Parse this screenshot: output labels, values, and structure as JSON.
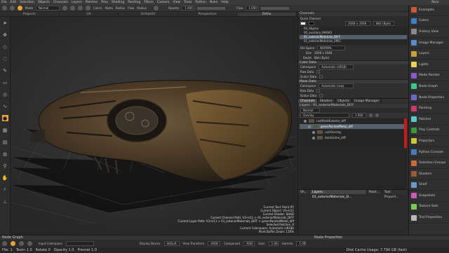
{
  "menubar": {
    "items": [
      "File",
      "Edit",
      "Selection",
      "Objects",
      "Channels",
      "Layers",
      "Patches",
      "Prex",
      "Shading",
      "Painting",
      "Filters",
      "Camera",
      "View",
      "Tools",
      "Python",
      "Nuke",
      "Help"
    ],
    "right_label": "Near"
  },
  "toolbar": {
    "mode_label": "Mode",
    "mode_value": "Normal",
    "colors_label": "Colors",
    "alpha_label": "Alpha",
    "radius_label": "Radius",
    "flow_label": "Flow",
    "radius2_label": "Radius",
    "opacity_label": "Opacity",
    "opacity_value": "1.000",
    "flow2_label": "Flow",
    "flow2_value": "1.000"
  },
  "view_tabs": [
    "Projects",
    "UV",
    "Ortho/UV",
    "Perspective",
    "Ortho"
  ],
  "active_view_tab": 4,
  "viewport": {
    "hud": [
      "Current Tool: Paint (P)",
      "Current Object: V3-m11",
      "Current Shader: SHAD",
      "Current Channel Path: V3-m11 > 01_exteriorMaterials_DIFF",
      "Current Layer Path: V3-m11 > 01_exteriorMaterials_DIFF > greenPaintedMetal_diff",
      "Selected Patches: 0",
      "Current Colorspace: Automatic (sRGB)",
      "Paint Buffer Zoom: 116%"
    ]
  },
  "right_panel": {
    "channels_title": "Channels",
    "quick_channel_label": "Quick Channel",
    "size_value": "2048 × 2048",
    "depth_value": "8bit (Byte)",
    "channel_list": [
      "00_Sbgrey",
      "00_auxiliary_MASKS",
      "01_exteriorMaterials_DIFF",
      "01_exteriorMaterials_SPEC"
    ],
    "selected_channel": 2,
    "file_space_label": "File Space",
    "file_space_value": "NORMAL",
    "size_label": "Size",
    "size2_value": "2048 x 2048",
    "depth_label": "Depth",
    "depth2_value": "8bit (Byte)",
    "color_data_label": "Color Data",
    "colorspace_label": "Colorspace",
    "colorspace_value": "Automatic (sRGB)",
    "raw_data_label": "Raw Data",
    "scalar_data_label": "Scalar Data",
    "mask_data_label": "Mask Data",
    "colorspace2_value": "Automatic (raw)",
    "sub_tabs": [
      "Channels",
      "Shaders",
      "Objects",
      "Image Manager"
    ],
    "active_sub_tab": 0,
    "layers_path": "Layers : 01_exteriorMaterials_DIFF",
    "blend_value": "Normal",
    "blend_mode": "Overlay",
    "blend_opacity": "1.000",
    "layers": [
      "rustPaintExterior_diff",
      "greenPaintedMetal_diff",
      "rustOverlay",
      "darkGrime_diff"
    ],
    "selected_layer": 1,
    "bottom_tabs": [
      "Sh...",
      "Layers : 01_exteriorMaterials_D...",
      "Palet...",
      "Tool Propert..."
    ]
  },
  "shelf": {
    "items": [
      "Examples",
      "Colors",
      "History View",
      "Image Manager",
      "Layers",
      "Lights",
      "Mode Render",
      "Node Graph",
      "Node Properties",
      "Painting",
      "Patches",
      "Play Controls",
      "Projectors",
      "Python Console",
      "Selection Groups",
      "Shaders",
      "Shelf",
      "Snapshots",
      "Texture Sets",
      "Tool Properties"
    ],
    "colors": [
      "#c85a3a",
      "#3a7fc8",
      "#8a8a8a",
      "#5a8ac8",
      "#c8a03a",
      "#e8d05a",
      "#8a5ac8",
      "#3ac88a",
      "#6a6ac8",
      "#c83a6a",
      "#5ac8c8",
      "#3a9a3a",
      "#c8c83a",
      "#4a7ab8",
      "#c86a3a",
      "#9a5a3a",
      "#6a9ac8",
      "#c85ab8",
      "#7ac85a",
      "#b8b8b8"
    ]
  },
  "bottom": {
    "node_graph_label": "Node Graph",
    "node_properties_label": "Node Properties",
    "input_colorspace_label": "Input Colorspace",
    "display_device_label": "Display Device",
    "display_device_value": "default",
    "view_transform_label": "View Transform",
    "view_transform_value": "sRGB",
    "component_label": "Component",
    "component_value": "RGB",
    "gain_label": "Gain",
    "gain_value": "1.00",
    "gamma_label": "Gamma",
    "gamma_value": "1.00",
    "status_left": [
      "File: 1",
      "Textn 1.0",
      "Rotate 0",
      "Opacity 1.0",
      "Fresnel 1.0"
    ],
    "status_right": "Disk Cache Usage: 7.790 GB (fast)"
  }
}
